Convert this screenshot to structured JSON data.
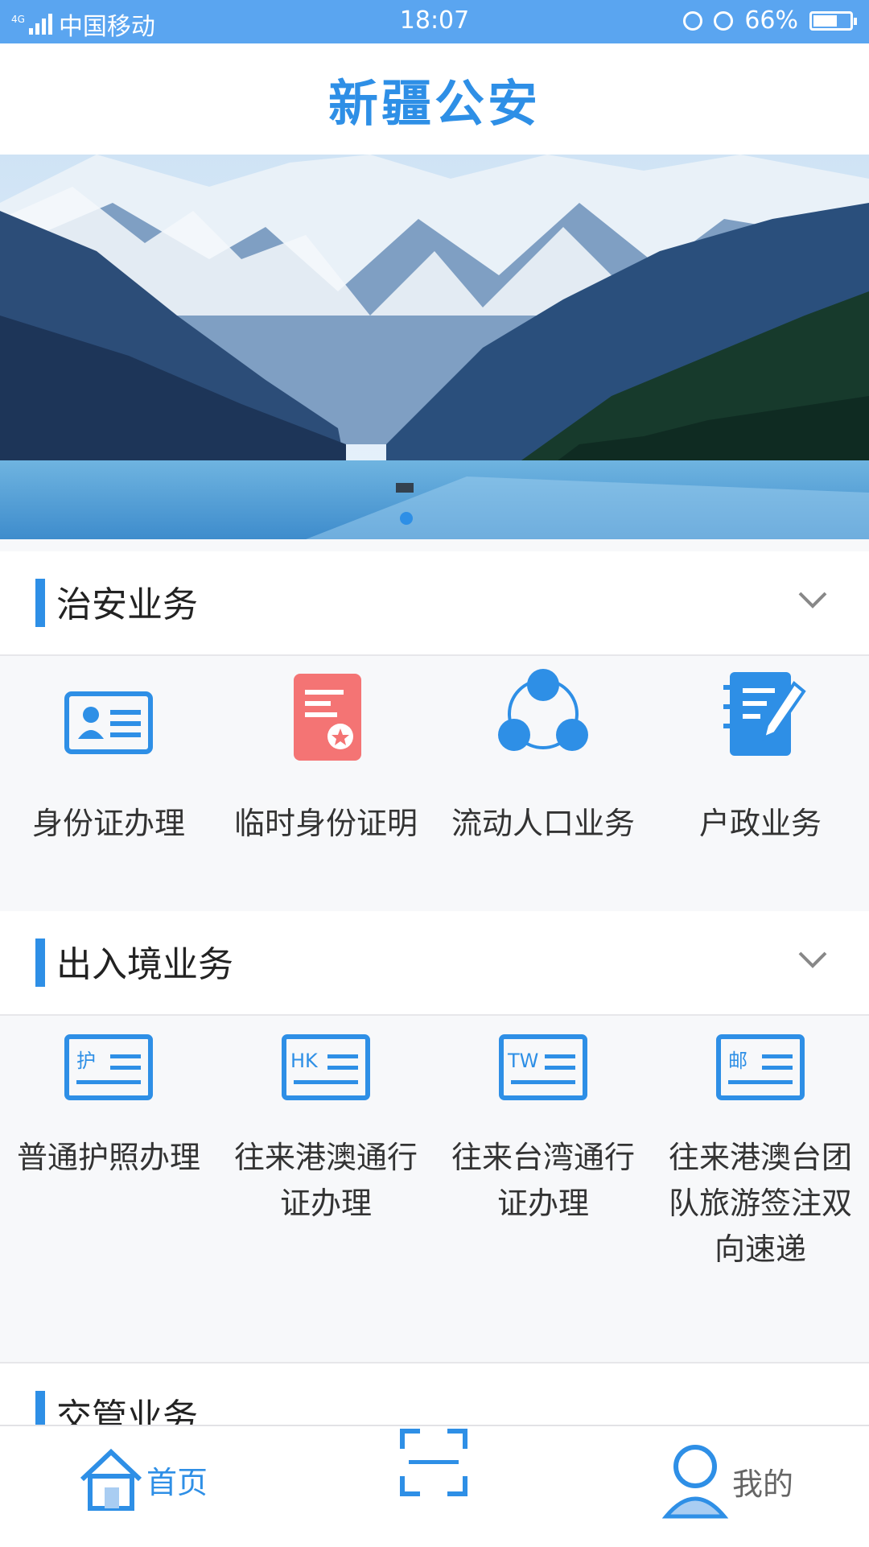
{
  "status": {
    "carrier": "中国移动",
    "network": "4G",
    "time": "18:07",
    "battery": "66%",
    "battery_level": 0.66
  },
  "header": {
    "title": "新疆公安"
  },
  "banner": {
    "slides": 1,
    "active_slide": 0
  },
  "sections": [
    {
      "title": "治安业务",
      "items": [
        {
          "label": "身份证办理",
          "icon": "id-card-icon"
        },
        {
          "label": "临时身份证明",
          "icon": "temp-certificate-icon"
        },
        {
          "label": "流动人口业务",
          "icon": "floating-population-icon"
        },
        {
          "label": "户政业务",
          "icon": "household-notebook-icon"
        }
      ]
    },
    {
      "title": "出入境业务",
      "items": [
        {
          "label": "普通护照办理",
          "icon": "passport-icon",
          "badge": "护"
        },
        {
          "label": "往来港澳通行证办理",
          "icon": "hk-pass-icon",
          "badge": "HK"
        },
        {
          "label": "往来台湾通行证办理",
          "icon": "tw-pass-icon",
          "badge": "TW"
        },
        {
          "label": "往来港澳台团队旅游签注双向速递",
          "icon": "mail-delivery-icon",
          "badge": "邮"
        }
      ]
    },
    {
      "title": "交管业务"
    }
  ],
  "tabbar": {
    "home": "首页",
    "scan": "scan-icon",
    "mine": "我的"
  },
  "colors": {
    "accent": "#2e8fe6",
    "statusbar": "#5aa5f0",
    "red_icon": "#f47474"
  }
}
